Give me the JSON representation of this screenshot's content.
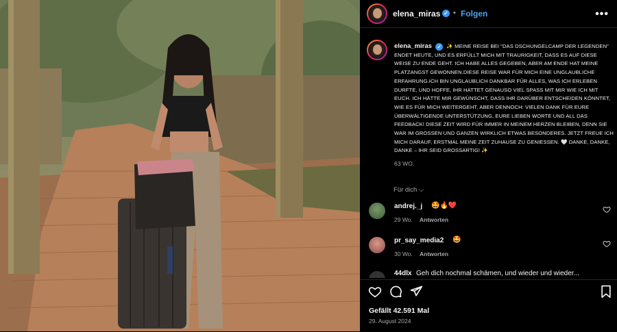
{
  "post": {
    "username": "elena_miras",
    "follow_label": "Folgen",
    "dot": "•",
    "more_label": "•••"
  },
  "caption": {
    "username": "elena_miras",
    "text": "✨ Meine Reise bei \"Das Dschungelcamp der Legenden\" endet heute, und es erfüllt mich mit Traurigkeit, dass es auf diese Weise zu Ende geht. Ich habe alles gegeben, aber am Ende hat meine Platzangst gewonnen.Diese Reise war für mich eine unglaubliche Erfahrung.Ich bin unglaublich dankbar für alles, was ich erleben durfte, und hoffe, ihr hattet genauso viel Spaß mit mir wie ich mit euch. Ich hätte mir gewünscht, dass ihr darüber entscheiden könntet, wie es für mich weitergeht, aber dennoch: Vielen Dank für eure überwältigende Unterstützung, eure lieben Worte und all das Feedback! Diese Zeit wird für immer in meinem Herzen bleiben, denn sie war im Großen und Ganzen wirklich etwas Besonderes. Jetzt freue ich mich darauf, erstmal meine Zeit zuhause zu genießen. 🤍 Danke, danke, danke – ihr seid großartig! ✨",
    "age": "63 Wo."
  },
  "for_you_label": "Für dich ⌵",
  "comments": [
    {
      "user": "andrej._j",
      "emoji": "🤩🔥❤️",
      "age": "29 Wo.",
      "reply_label": "Antworten"
    },
    {
      "user": "pr_say_media2",
      "emoji": "🤩",
      "age": "30 Wo.",
      "reply_label": "Antworten"
    }
  ],
  "partial_comment": {
    "user": "44dlx",
    "text": "Geh dich nochmal schämen, und wieder und wieder..."
  },
  "actions": {
    "likes": "Gefällt 42.591 Mal",
    "date": "29. August 2024"
  },
  "icons": [
    "heart-icon",
    "comment-icon",
    "share-icon",
    "bookmark-icon",
    "verified-icon",
    "more-icon"
  ],
  "colors": {
    "accent": "#4aa3f5",
    "verified": "#3897f0",
    "background": "#000000"
  }
}
